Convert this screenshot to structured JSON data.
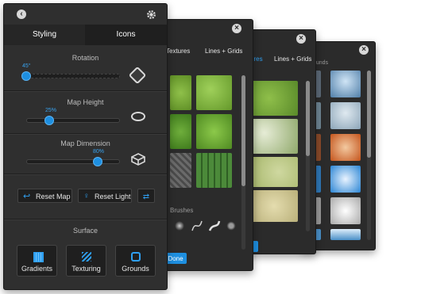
{
  "main": {
    "tabs": [
      {
        "label": "Styling"
      },
      {
        "label": "Icons"
      }
    ],
    "rotation": {
      "label": "Rotation",
      "value": "45°"
    },
    "map_height": {
      "label": "Map Height",
      "value": "25%"
    },
    "map_dimension": {
      "label": "Map Dimension",
      "value": "80%"
    },
    "buttons": {
      "reset_map": "Reset Map",
      "reset_light": "Reset Light"
    },
    "surface": {
      "label": "Surface",
      "items": [
        {
          "label": "Gradients"
        },
        {
          "label": "Texturing"
        },
        {
          "label": "Grounds"
        }
      ]
    }
  },
  "panel2": {
    "tabs": [
      {
        "label": "Textures"
      },
      {
        "label": "Lines + Grids"
      }
    ],
    "brushes_label": "Brushes",
    "done_label": "Done"
  },
  "panel3": {
    "tabs": [
      {
        "label": "ures"
      },
      {
        "label": "Lines + Grids"
      }
    ],
    "done_label": "e"
  },
  "panel4": {
    "tab_label": "ounds"
  },
  "colors": {
    "accent": "#1e8fe0",
    "panel_bg": "#2f2f2f",
    "button_bg": "#1f1f1f"
  }
}
